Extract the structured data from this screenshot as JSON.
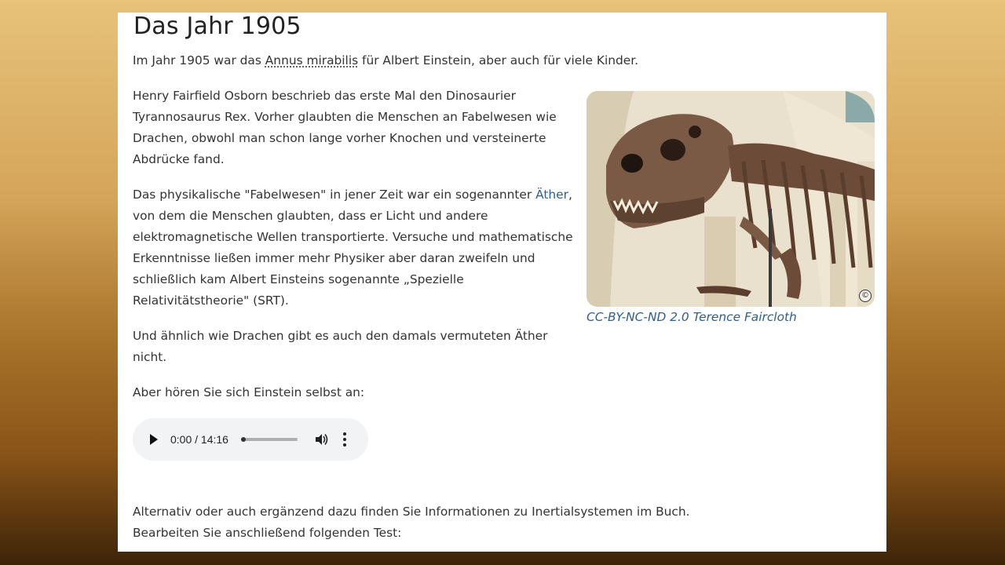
{
  "title": "Das Jahr 1905",
  "intro": {
    "before": "Im Jahr 1905 war das ",
    "abbr": "Annus mirabilis",
    "after": " für Albert Einstein,  aber auch für viele Kinder."
  },
  "para1": "Henry Fairfield Osborn beschrieb das erste Mal den Dinosaurier Tyrannosaurus Rex. Vorher glaubten die Menschen an Fabelwesen wie Drachen, obwohl man schon lange vorher Knochen und versteinerte Abdrücke fand.",
  "para2": {
    "before": "Das physikalische \"Fabelwesen\" in jener Zeit war ein sogenannter ",
    "link": "Äther",
    "after": ", von dem die Menschen glaubten, dass er Licht und andere elektromagnetische Wellen transportierte. Versuche und mathematische Erkenntnisse ließen immer mehr Physiker aber daran zweifeln und schließlich kam Albert Einsteins sogenannte „Spezielle Relativitätstheorie\" (SRT)."
  },
  "para3": "Und ähnlich wie Drachen gibt es auch den damals vermuteten Äther nicht.",
  "para4": "Aber hören Sie sich Einstein selbst an:",
  "figure": {
    "caption": "CC-BY-NC-ND 2.0 Terence Faircloth",
    "copyright_symbol": "©"
  },
  "audio": {
    "time": "0:00 / 14:16",
    "progress": 0.0
  },
  "para5": "Alternativ oder auch ergänzend dazu finden Sie Informationen zu Inertialsystemen im Buch.",
  "para6": "Bearbeiten Sie anschließend folgenden Test:"
}
